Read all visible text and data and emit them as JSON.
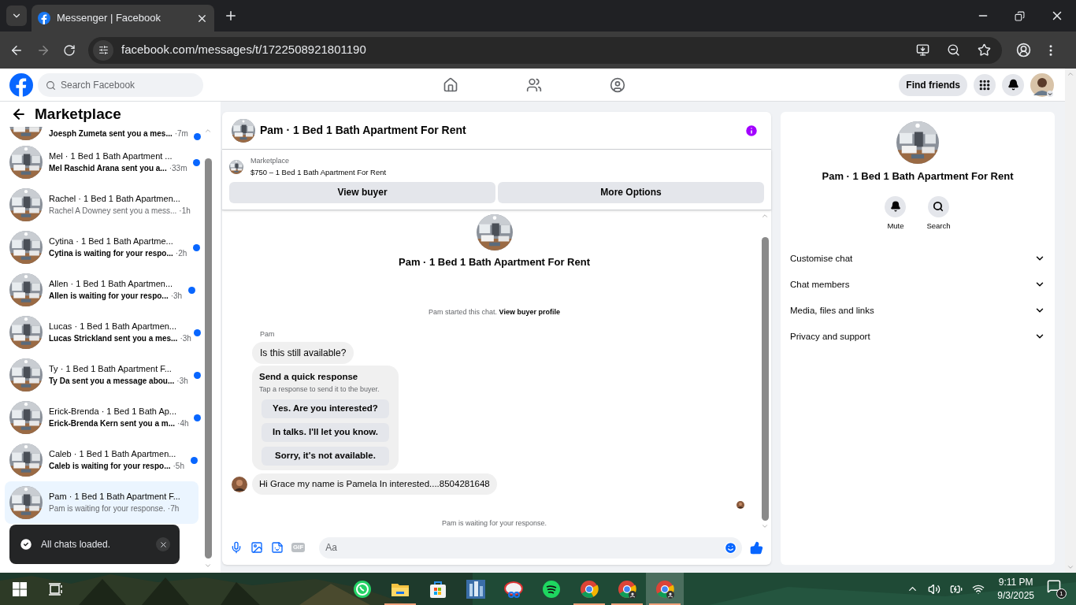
{
  "browser": {
    "tab_title": "Messenger | Facebook",
    "url": "facebook.com/messages/t/1722508921801190"
  },
  "header": {
    "search_placeholder": "Search Facebook",
    "find_friends": "Find friends"
  },
  "sidebar": {
    "title": "Marketplace",
    "chats": [
      {
        "preview": "Joesph Zumeta sent you a mes...",
        "time": "·7m",
        "unread": true,
        "selected": false
      },
      {
        "title": "Mel · 1 Bed 1 Bath Apartment ...",
        "preview": "Mel Raschid Arana sent you a...",
        "time": "·33m",
        "unread": true,
        "selected": false
      },
      {
        "title": "Rachel · 1 Bed 1 Bath Apartmen...",
        "preview": "Rachel A Downey sent you a mess...",
        "time": "·1h",
        "unread": false,
        "selected": false
      },
      {
        "title": "Cytina · 1 Bed 1 Bath Apartme...",
        "preview": "Cytina is waiting for your respo...",
        "time": "·2h",
        "unread": true,
        "selected": false
      },
      {
        "title": "Allen · 1 Bed 1 Bath Apartmen...",
        "preview": "Allen is waiting for your respo...",
        "time": "·3h",
        "unread": true,
        "selected": false
      },
      {
        "title": "Lucas · 1 Bed 1 Bath Apartmen...",
        "preview": "Lucas Strickland sent you a mes...",
        "time": "·3h",
        "unread": true,
        "selected": false
      },
      {
        "title": "Ty · 1 Bed 1 Bath Apartment F...",
        "preview": "Ty Da sent you a message abou...",
        "time": "·3h",
        "unread": true,
        "selected": false
      },
      {
        "title": "Erick-Brenda · 1 Bed 1 Bath Ap...",
        "preview": "Erick-Brenda Kern sent you a m...",
        "time": "·4h",
        "unread": true,
        "selected": false
      },
      {
        "title": "Caleb · 1 Bed 1 Bath Apartmen...",
        "preview": "Caleb is waiting for your respo...",
        "time": "·5h",
        "unread": true,
        "selected": false
      },
      {
        "title": "Pam · 1 Bed 1 Bath Apartment F...",
        "preview": "Pam is waiting for your response.",
        "time": "·7h",
        "unread": false,
        "selected": true
      }
    ]
  },
  "toast": {
    "text": "All chats loaded."
  },
  "chat": {
    "title": "Pam · 1 Bed 1 Bath Apartment For Rent",
    "listing": {
      "label": "Marketplace",
      "item": "$750 – 1 Bed 1 Bath Apartment For Rent"
    },
    "buttons": [
      "View buyer",
      "More Options"
    ],
    "intro_title": "Pam · 1 Bed 1 Bath Apartment For Rent",
    "started_text": "Pam started this chat.",
    "started_link": "View buyer profile",
    "sender": "Pam",
    "first_message": "Is this still available?",
    "quick_response": {
      "title": "Send a quick response",
      "hint": "Tap a response to send it to the buyer.",
      "options": [
        "Yes. Are you interested?",
        "In talks. I'll let you know.",
        "Sorry, it's not available."
      ]
    },
    "reply": "Hi Grace my name is Pamela In interested....8504281648",
    "status": "Pam is waiting for your response.",
    "composer": {
      "placeholder": "Aa",
      "gif_label": "GIF"
    }
  },
  "details": {
    "title": "Pam · 1 Bed 1 Bath Apartment For Rent",
    "actions": [
      {
        "kind": "mute",
        "label": "Mute"
      },
      {
        "kind": "search",
        "label": "Search"
      }
    ],
    "sections": [
      "Customise chat",
      "Chat members",
      "Media, files and links",
      "Privacy and support"
    ]
  },
  "taskbar": {
    "apps": [
      {
        "kind": "whatsapp",
        "running": false,
        "selected": false
      },
      {
        "kind": "folder",
        "running": true,
        "selected": false
      },
      {
        "kind": "store",
        "running": false,
        "selected": false
      },
      {
        "kind": "tile",
        "running": false,
        "selected": false
      },
      {
        "kind": "snip",
        "running": false,
        "selected": false
      },
      {
        "kind": "spotify",
        "running": false,
        "selected": false
      },
      {
        "kind": "chrome",
        "running": true,
        "selected": false
      },
      {
        "kind": "chrome-profile",
        "running": true,
        "selected": false
      },
      {
        "kind": "chrome-profile",
        "running": true,
        "selected": true
      }
    ],
    "time": "9:11 PM",
    "date": "9/3/2025",
    "notifications": "1"
  }
}
